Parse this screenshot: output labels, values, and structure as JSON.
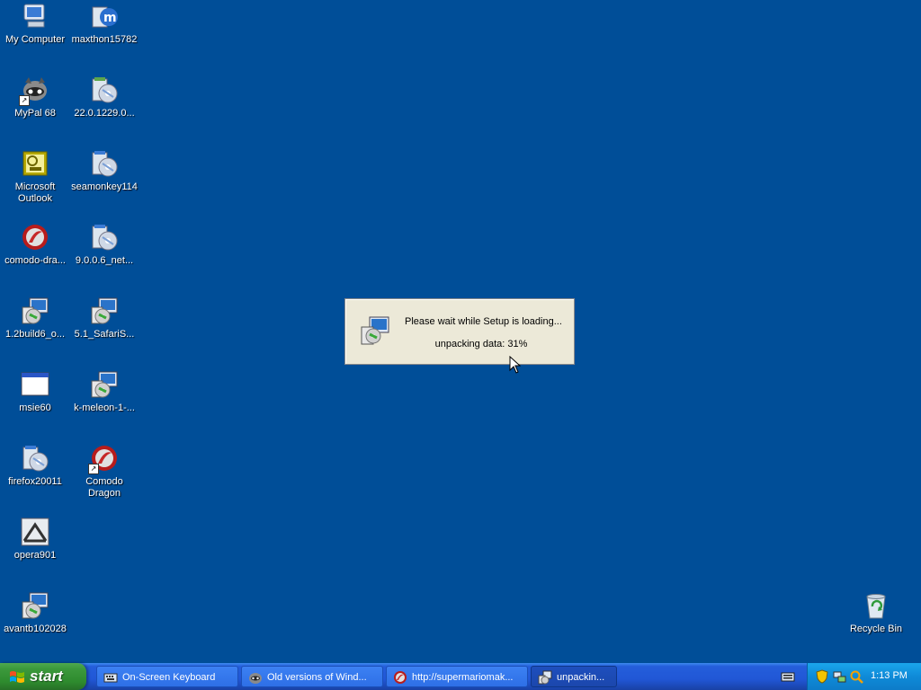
{
  "desktop": {
    "icons": [
      {
        "label": "My Computer"
      },
      {
        "label": "maxthon15782"
      },
      {
        "label": "MyPal 68"
      },
      {
        "label": "22.0.1229.0..."
      },
      {
        "label": "Microsoft Outlook"
      },
      {
        "label": "seamonkey114"
      },
      {
        "label": "comodo-dra..."
      },
      {
        "label": "9.0.0.6_net..."
      },
      {
        "label": "1.2build6_o..."
      },
      {
        "label": "5.1_SafariS..."
      },
      {
        "label": "msie60"
      },
      {
        "label": "k-meleon-1-..."
      },
      {
        "label": "firefox20011"
      },
      {
        "label": "Comodo Dragon"
      },
      {
        "label": "opera901"
      },
      {
        "label": "avantb102028"
      },
      {
        "label": "Recycle Bin"
      }
    ]
  },
  "setup_dialog": {
    "message": "Please wait while Setup is loading...",
    "progress_text": "unpacking data: 31%",
    "progress_percent": 31
  },
  "taskbar": {
    "start_label": "start",
    "buttons": [
      {
        "label": "On-Screen Keyboard"
      },
      {
        "label": "Old versions of Wind..."
      },
      {
        "label": "http://supermariomak..."
      },
      {
        "label": "unpackin..."
      }
    ],
    "clock": "1:13 PM"
  },
  "colors": {
    "desktop_background": "#004e98",
    "taskbar": "#245edb",
    "start_button": "#3c9a3c",
    "tray": "#0f8ad8",
    "dialog_background": "#ece9d8"
  }
}
